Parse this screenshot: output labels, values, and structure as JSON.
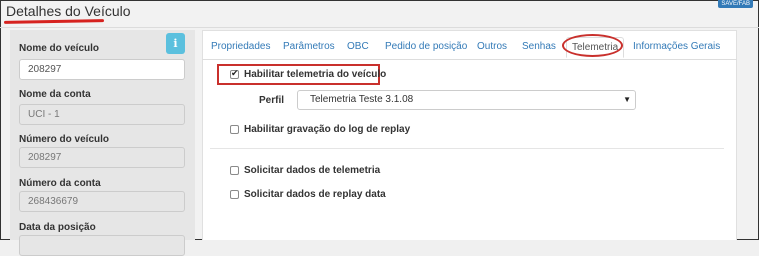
{
  "header": {
    "title": "Detalhes do Veículo",
    "corner_button": "SAVE/FAB"
  },
  "left": {
    "info_icon": "info-icon",
    "fields": [
      {
        "label": "Nome do veículo",
        "value": "208297"
      },
      {
        "label": "Nome da conta",
        "value": "UCI - 1"
      },
      {
        "label": "Número do veículo",
        "value": "208297"
      },
      {
        "label": "Número da conta",
        "value": "268436679"
      },
      {
        "label": "Data da posição",
        "value": ""
      }
    ]
  },
  "tabs": [
    "Propriedades",
    "Parâmetros",
    "OBC",
    "Pedido de posição",
    "Outros",
    "Senhas",
    "Telemetria",
    "Informações Gerais"
  ],
  "active_tab": "Telemetria",
  "telemetry": {
    "enable_label": "Habilitar telemetria do veículo",
    "enable_checked": true,
    "perfil_label": "Perfil",
    "perfil_value": "Telemetria Teste 3.1.08",
    "replay_log_label": "Habilitar gravação do log de replay",
    "request_telemetry_label": "Solicitar dados de telemetria",
    "request_replay_label": "Solicitar dados de replay data"
  },
  "colors": {
    "accent": "#337ab7",
    "annotation_red": "#c9302c",
    "info": "#5bc0de"
  }
}
